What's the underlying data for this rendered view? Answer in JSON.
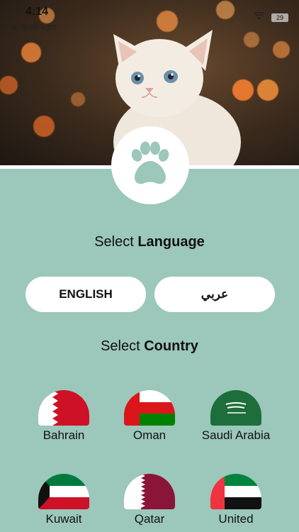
{
  "status": {
    "time": "4:14",
    "back_label": "◄ TestFlight",
    "battery": "29",
    "signal_dots": "...."
  },
  "icons": {
    "paw": "paw-icon",
    "wifi": "wifi-icon",
    "battery": "battery-icon"
  },
  "language_section": {
    "prefix": "Select ",
    "bold": "Language",
    "options": [
      {
        "label": "ENGLISH"
      },
      {
        "label": "عربي"
      }
    ]
  },
  "country_section": {
    "prefix": "Select ",
    "bold": "Country",
    "countries": [
      {
        "name": "Bahrain"
      },
      {
        "name": "Oman"
      },
      {
        "name": "Saudi Arabia"
      },
      {
        "name": "Kuwait"
      },
      {
        "name": "Qatar"
      },
      {
        "name": "United"
      }
    ]
  },
  "colors": {
    "background": "#9cc7bb",
    "paw": "#9cc7bb",
    "button_bg": "#ffffff"
  }
}
